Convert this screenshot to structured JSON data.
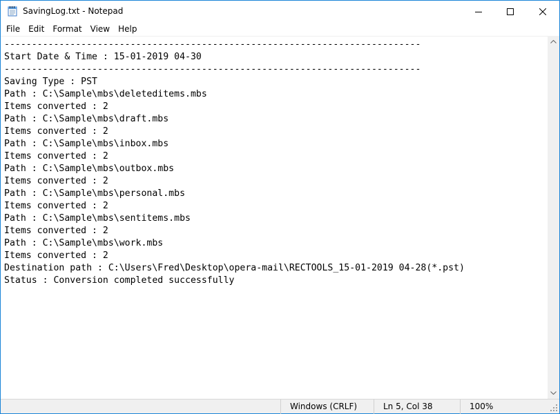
{
  "window": {
    "title": "SavingLog.txt - Notepad"
  },
  "menu": {
    "items": [
      "File",
      "Edit",
      "Format",
      "View",
      "Help"
    ]
  },
  "editor": {
    "content": "----------------------------------------------------------------------------\nStart Date & Time : 15-01-2019 04-30\n----------------------------------------------------------------------------\nSaving Type : PST\nPath : C:\\Sample\\mbs\\deleteditems.mbs\nItems converted : 2\nPath : C:\\Sample\\mbs\\draft.mbs\nItems converted : 2\nPath : C:\\Sample\\mbs\\inbox.mbs\nItems converted : 2\nPath : C:\\Sample\\mbs\\outbox.mbs\nItems converted : 2\nPath : C:\\Sample\\mbs\\personal.mbs\nItems converted : 2\nPath : C:\\Sample\\mbs\\sentitems.mbs\nItems converted : 2\nPath : C:\\Sample\\mbs\\work.mbs\nItems converted : 2\nDestination path : C:\\Users\\Fred\\Desktop\\opera-mail\\RECTOOLS_15-01-2019 04-28(*.pst)\nStatus : Conversion completed successfully"
  },
  "statusbar": {
    "line_ending": "Windows (CRLF)",
    "cursor_position": "Ln 5, Col 38",
    "zoom": "100%"
  },
  "icons": {
    "app": "notepad-icon",
    "minimize": "minimize-icon",
    "maximize": "maximize-icon",
    "close": "close-icon",
    "scroll_up": "chevron-up-icon",
    "scroll_down": "chevron-down-icon",
    "size_grip": "size-grip-icon"
  },
  "colors": {
    "window_border": "#1883d7",
    "chrome_background": "#f0f0f0"
  }
}
